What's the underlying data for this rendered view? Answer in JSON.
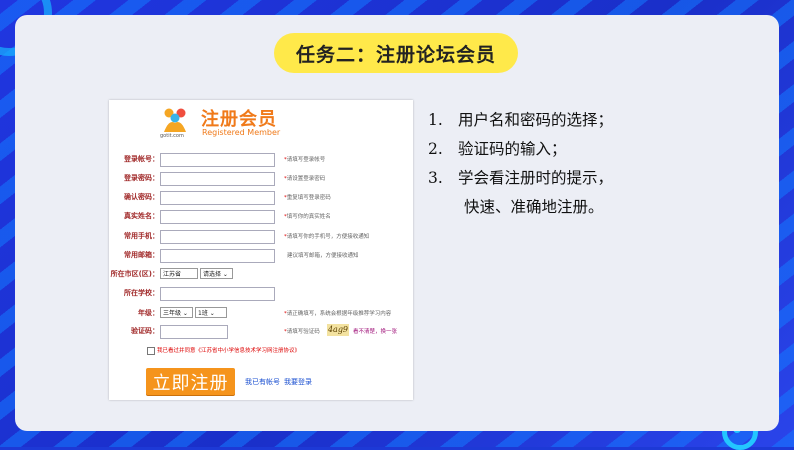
{
  "slide": {
    "title": "任务二：注册论坛会员"
  },
  "form": {
    "logo_caption": "gotit.com",
    "title": "注册会员",
    "subtitle": "Registered Member",
    "fields": [
      {
        "label": "登录帐号：",
        "hint": "请填写登录帐号"
      },
      {
        "label": "登录密码：",
        "hint": "请设置登录密码"
      },
      {
        "label": "确认密码：",
        "hint": "重复填写登录密码"
      },
      {
        "label": "真实姓名：",
        "hint": "填写你的真实姓名"
      },
      {
        "label": "常用手机：",
        "hint": "请填写你的手机号，方便接收通知"
      },
      {
        "label": "常用邮箱：",
        "hint": "建议填写邮箱，方便接收通知"
      }
    ],
    "region": {
      "label": "所在市区(区)：",
      "province": "江苏省",
      "city": "请选择"
    },
    "school": {
      "label": "所在学校："
    },
    "grade": {
      "label": "年级：",
      "grade_value": "三年级",
      "class_value": "1班",
      "hint": "请正确填写，系统会根据年级推荐学习内容"
    },
    "captcha": {
      "label": "验证码：",
      "hint": "请填写验证码",
      "code": "4ag9",
      "refresh": "看不清楚，换一张"
    },
    "agree_text": "我已看过并同意《江苏省中小学信息技术学习网注册协议》",
    "submit_label": "立即注册",
    "have_account": "我已有帐号",
    "login_link": "我要登录"
  },
  "steps": [
    {
      "num": "1.",
      "text": "用户名和密码的选择；"
    },
    {
      "num": "2.",
      "text": "验证码的输入；"
    },
    {
      "num": "3.",
      "text": "学会看注册时的提示，"
    },
    {
      "num": "",
      "text": "快速、准确地注册。"
    }
  ],
  "colors": {
    "background": "#1d39d6",
    "card": "#eceef5",
    "title_pill": "#ffe94a",
    "form_accent": "#f07a1a",
    "submit": "#f5941c"
  }
}
